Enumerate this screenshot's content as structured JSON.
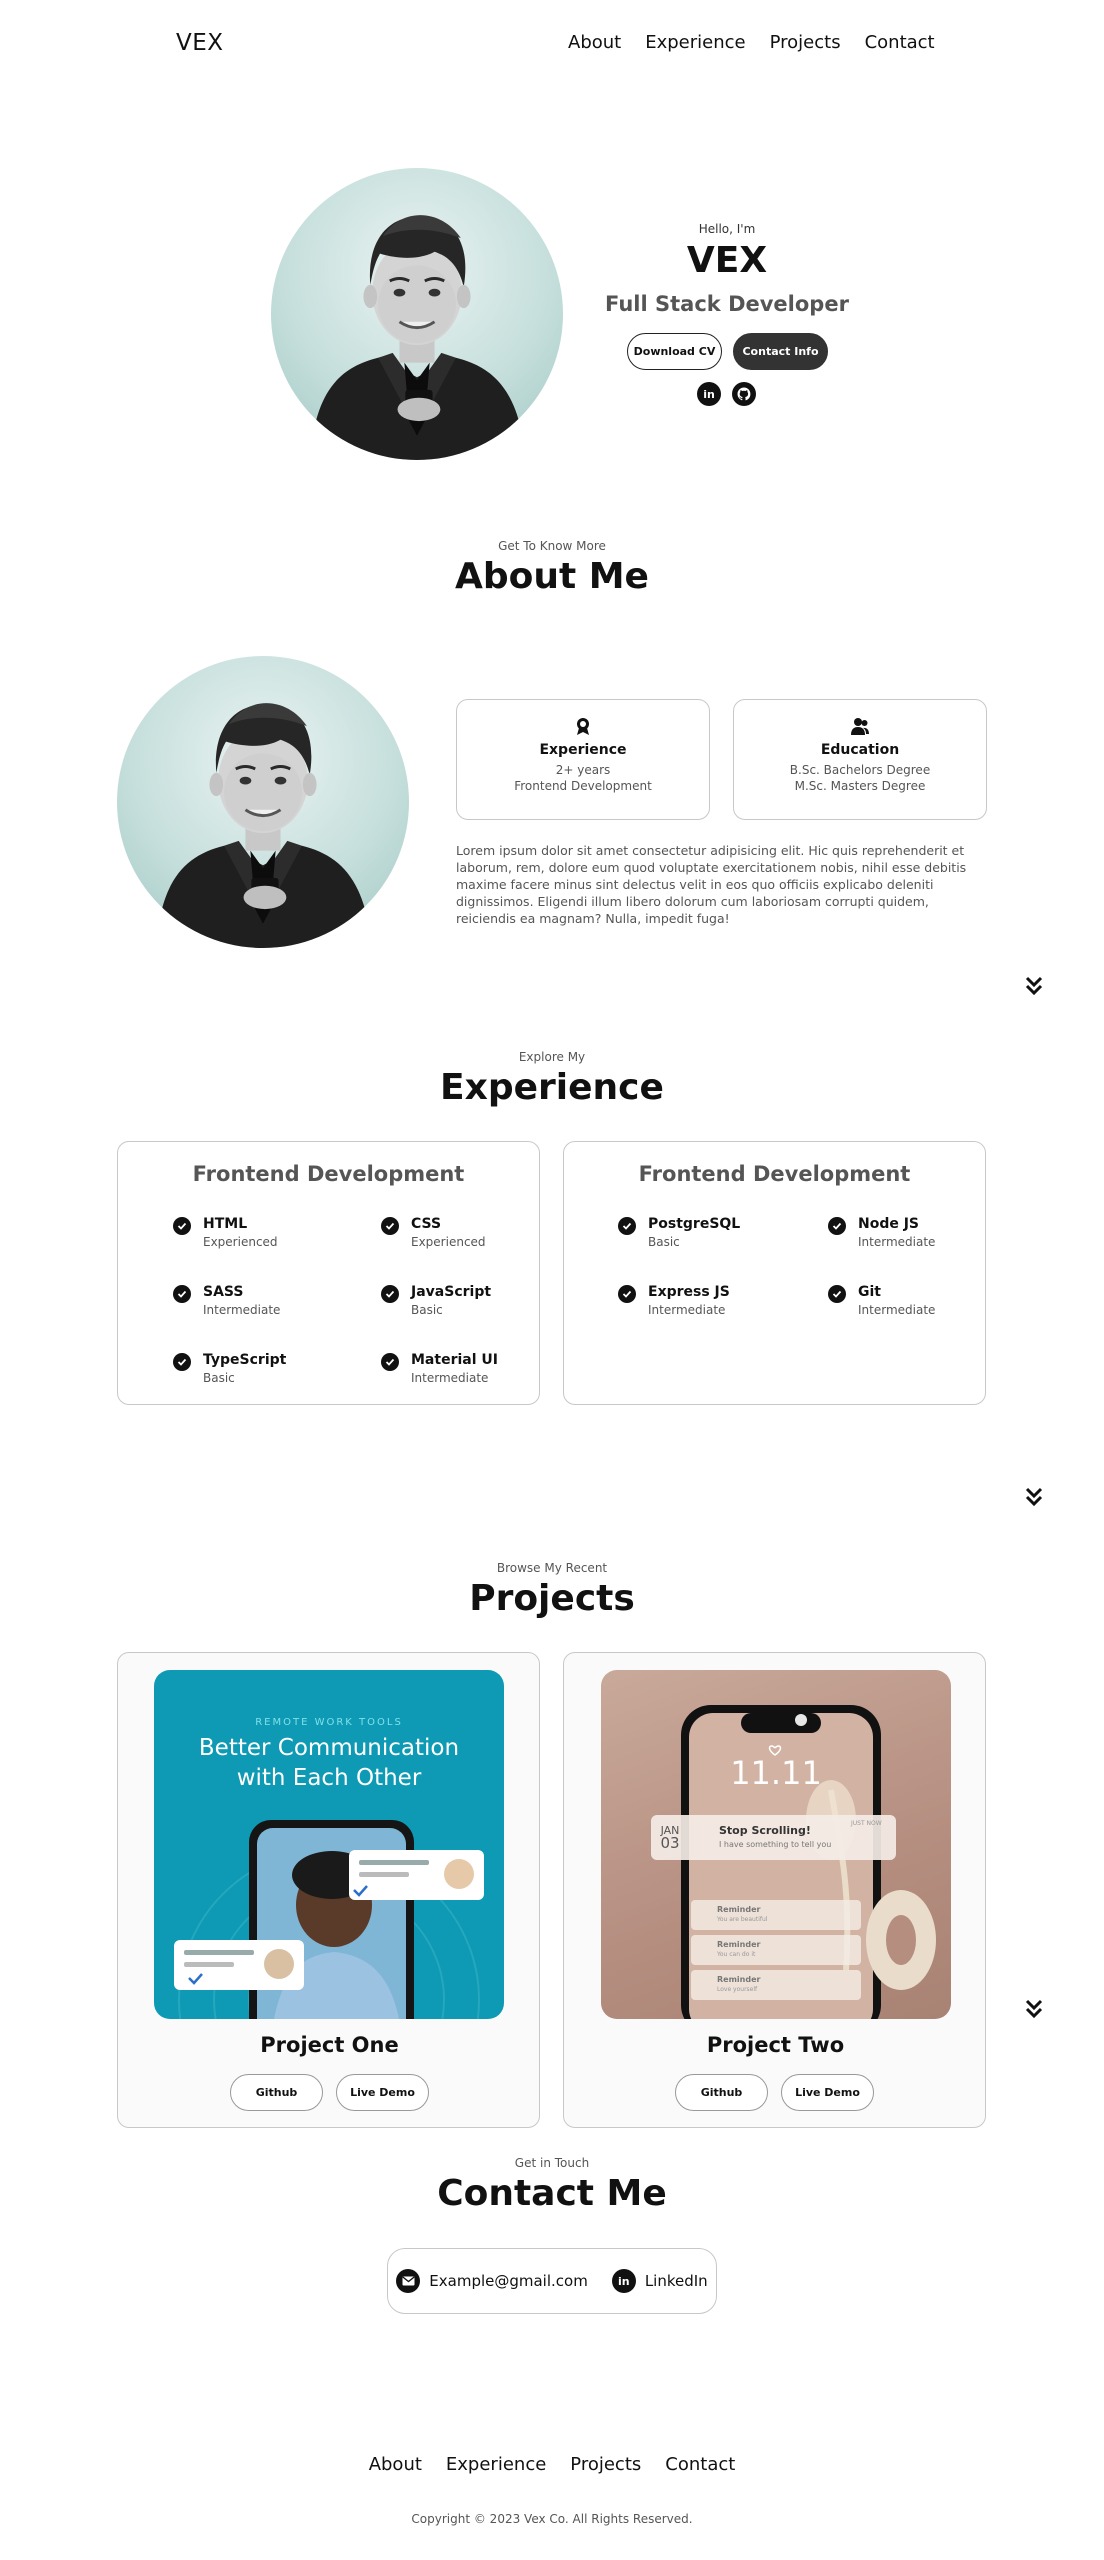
{
  "header": {
    "logo": "VEX",
    "nav": [
      "About",
      "Experience",
      "Projects",
      "Contact"
    ]
  },
  "hero": {
    "greeting": "Hello, I'm",
    "name": "VEX",
    "role": "Full Stack Developer",
    "download_cv": "Download CV",
    "contact_info": "Contact Info",
    "social_icons": [
      "linkedin-icon",
      "github-icon"
    ]
  },
  "about": {
    "subtitle": "Get To Know More",
    "title": "About Me",
    "experience": {
      "icon": "award-icon",
      "title": "Experience",
      "lines": [
        "2+ years",
        "Frontend Development"
      ]
    },
    "education": {
      "icon": "users-icon",
      "title": "Education",
      "lines": [
        "B.Sc. Bachelors Degree",
        "M.Sc. Masters Degree"
      ]
    },
    "paragraph": "Lorem ipsum dolor sit amet consectetur adipisicing elit. Hic quis reprehenderit et laborum, rem, dolore eum quod voluptate exercitationem nobis, nihil esse debitis maxime facere minus sint delectus velit in eos quo officiis explicabo deleniti dignissimos. Eligendi illum libero dolorum cum laboriosam corrupti quidem, reiciendis ea magnam? Nulla, impedit fuga!"
  },
  "experience": {
    "subtitle": "Explore My",
    "title": "Experience",
    "cards": [
      {
        "title": "Frontend Development",
        "skills": [
          {
            "name": "HTML",
            "level": "Experienced"
          },
          {
            "name": "CSS",
            "level": "Experienced"
          },
          {
            "name": "SASS",
            "level": "Intermediate"
          },
          {
            "name": "JavaScript",
            "level": "Basic"
          },
          {
            "name": "TypeScript",
            "level": "Basic"
          },
          {
            "name": "Material UI",
            "level": "Intermediate"
          }
        ]
      },
      {
        "title": "Frontend Development",
        "skills": [
          {
            "name": "PostgreSQL",
            "level": "Basic"
          },
          {
            "name": "Node JS",
            "level": "Intermediate"
          },
          {
            "name": "Express JS",
            "level": "Intermediate"
          },
          {
            "name": "Git",
            "level": "Intermediate"
          }
        ]
      }
    ]
  },
  "projects": {
    "subtitle": "Browse My Recent",
    "title": "Projects",
    "items": [
      {
        "name": "Project One",
        "image_tag": "REMOTE WORK TOOLS",
        "image_headline_1": "Better Communication",
        "image_headline_2": "with Each Other",
        "github": "Github",
        "demo": "Live Demo"
      },
      {
        "name": "Project Two",
        "image_time": "11.11",
        "image_month": "JAN",
        "image_day": "03",
        "image_notif_title": "Stop Scrolling!",
        "image_notif_body": "I have something to tell you",
        "image_notif_time": "JUST NOW",
        "image_reminders": [
          "Reminder",
          "Reminder",
          "Reminder"
        ],
        "image_reminder_subs": [
          "You are beautiful",
          "You can do it",
          "Love yourself"
        ],
        "github": "Github",
        "demo": "Live Demo"
      }
    ]
  },
  "contact": {
    "subtitle": "Get in Touch",
    "title": "Contact Me",
    "email": "Example@gmail.com",
    "linkedin": "LinkedIn"
  },
  "footer": {
    "nav": [
      "About",
      "Experience",
      "Projects",
      "Contact"
    ],
    "copyright": "Copyright © 2023 Vex Co. All Rights Reserved."
  },
  "colors": {
    "accent_teal": "#0e9ab4",
    "dark_button": "#333333",
    "border": "#c8c8c8"
  }
}
